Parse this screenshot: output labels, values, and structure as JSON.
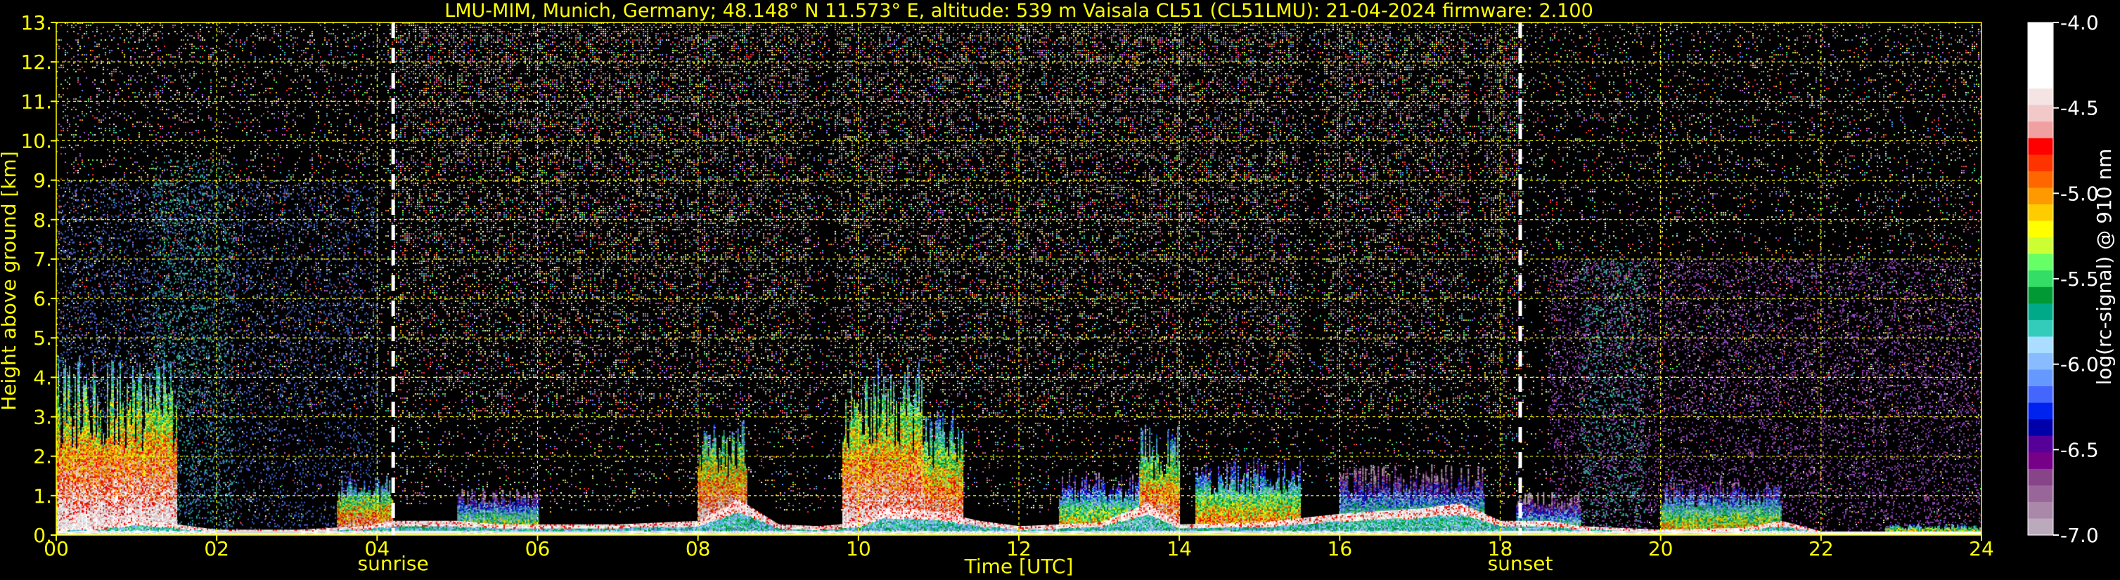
{
  "chart_data": {
    "type": "heatmap",
    "title": "LMU-MIM, Munich, Germany; 48.148° N 11.573° E, altitude: 539 m    Vaisala CL51 (CL51LMU): 21-04-2024    firmware: 2.100",
    "xlabel": "Time [UTC]",
    "ylabel": "Height above ground [km]",
    "xlim": [
      0,
      24
    ],
    "ylim": [
      0,
      13
    ],
    "x_ticks": [
      "00",
      "02",
      "04",
      "06",
      "08",
      "10",
      "12",
      "14",
      "16",
      "18",
      "20",
      "22",
      "24"
    ],
    "y_ticks": [
      "0.",
      "1.",
      "2.",
      "3.",
      "4.",
      "5.",
      "6.",
      "7.",
      "8.",
      "9.",
      "10.",
      "11.",
      "12.",
      "13."
    ],
    "grid": true,
    "events": [
      {
        "label": "sunrise",
        "time": 4.2
      },
      {
        "label": "sunset",
        "time": 18.25
      }
    ],
    "colorbar": {
      "label": "log(rc-signal) @ 910 nm",
      "range": [
        -7.0,
        -4.0
      ],
      "ticks": [
        "-4.0",
        "-4.5",
        "-5.0",
        "-5.5",
        "-6.0",
        "-6.5",
        "-7.0"
      ],
      "colors": [
        "#ffffff",
        "#ffffff",
        "#ffffff",
        "#ffffff",
        "#f4e4e4",
        "#f2c8c8",
        "#f0a0a0",
        "#ff0000",
        "#ff3300",
        "#ff6600",
        "#ff9900",
        "#ffcc00",
        "#ffff00",
        "#ccff33",
        "#66ff66",
        "#33dd66",
        "#009933",
        "#00aa88",
        "#33ccbb",
        "#aaddff",
        "#88bbff",
        "#6699ff",
        "#4466ff",
        "#0022ee",
        "#0000aa",
        "#550099",
        "#770088",
        "#884488",
        "#996699",
        "#aa88aa",
        "#bbaabb"
      ]
    },
    "boundary_layer_top_km": [
      [
        0.0,
        0.4
      ],
      [
        0.5,
        0.5
      ],
      [
        1.0,
        0.9
      ],
      [
        1.5,
        0.6
      ],
      [
        2.0,
        0.3
      ],
      [
        3.0,
        0.3
      ],
      [
        3.8,
        0.5
      ],
      [
        4.2,
        0.8
      ],
      [
        5.0,
        0.8
      ],
      [
        5.5,
        0.6
      ],
      [
        6.0,
        0.6
      ],
      [
        7.0,
        0.6
      ],
      [
        8.0,
        0.8
      ],
      [
        8.5,
        2.0
      ],
      [
        9.0,
        0.6
      ],
      [
        9.5,
        0.5
      ],
      [
        10.0,
        0.7
      ],
      [
        10.3,
        1.5
      ],
      [
        11.0,
        1.3
      ],
      [
        11.5,
        0.8
      ],
      [
        12.0,
        0.5
      ],
      [
        13.0,
        0.7
      ],
      [
        13.6,
        1.8
      ],
      [
        14.0,
        0.6
      ],
      [
        15.0,
        0.7
      ],
      [
        16.0,
        1.2
      ],
      [
        17.0,
        1.5
      ],
      [
        17.5,
        1.8
      ],
      [
        18.0,
        0.8
      ],
      [
        18.6,
        0.8
      ],
      [
        19.0,
        0.5
      ],
      [
        19.5,
        0.4
      ],
      [
        20.0,
        0.3
      ],
      [
        21.0,
        0.4
      ],
      [
        21.5,
        0.8
      ],
      [
        22.0,
        0.2
      ],
      [
        23.0,
        0.2
      ],
      [
        24.0,
        0.2
      ]
    ],
    "aerosol_layers": [
      {
        "t0": 0.0,
        "t1": 1.5,
        "base": 0.1,
        "top": 4.6,
        "intensity": -4.2
      },
      {
        "t0": 3.5,
        "t1": 4.2,
        "base": 0.2,
        "top": 1.6,
        "intensity": -4.6
      },
      {
        "t0": 5.0,
        "t1": 6.0,
        "base": 0.2,
        "top": 1.2,
        "intensity": -5.2
      },
      {
        "t0": 8.0,
        "t1": 8.6,
        "base": 0.2,
        "top": 3.0,
        "intensity": -4.3
      },
      {
        "t0": 9.8,
        "t1": 10.8,
        "base": 0.2,
        "top": 4.5,
        "intensity": -4.3
      },
      {
        "t0": 10.8,
        "t1": 11.3,
        "base": 0.3,
        "top": 3.2,
        "intensity": -4.4
      },
      {
        "t0": 12.5,
        "t1": 13.5,
        "base": 0.2,
        "top": 1.6,
        "intensity": -5.0
      },
      {
        "t0": 13.5,
        "t1": 14.0,
        "base": 0.2,
        "top": 2.8,
        "intensity": -4.4
      },
      {
        "t0": 14.2,
        "t1": 15.5,
        "base": 0.2,
        "top": 2.0,
        "intensity": -4.8
      },
      {
        "t0": 16.0,
        "t1": 17.8,
        "base": 0.2,
        "top": 1.8,
        "intensity": -5.3
      },
      {
        "t0": 18.2,
        "t1": 19.0,
        "base": 0.2,
        "top": 1.1,
        "intensity": -5.5
      },
      {
        "t0": 20.0,
        "t1": 21.5,
        "base": 0.1,
        "top": 1.4,
        "intensity": -5.0
      },
      {
        "t0": 22.8,
        "t1": 24.0,
        "base": 0.0,
        "top": 0.3,
        "intensity": -4.5
      }
    ]
  }
}
